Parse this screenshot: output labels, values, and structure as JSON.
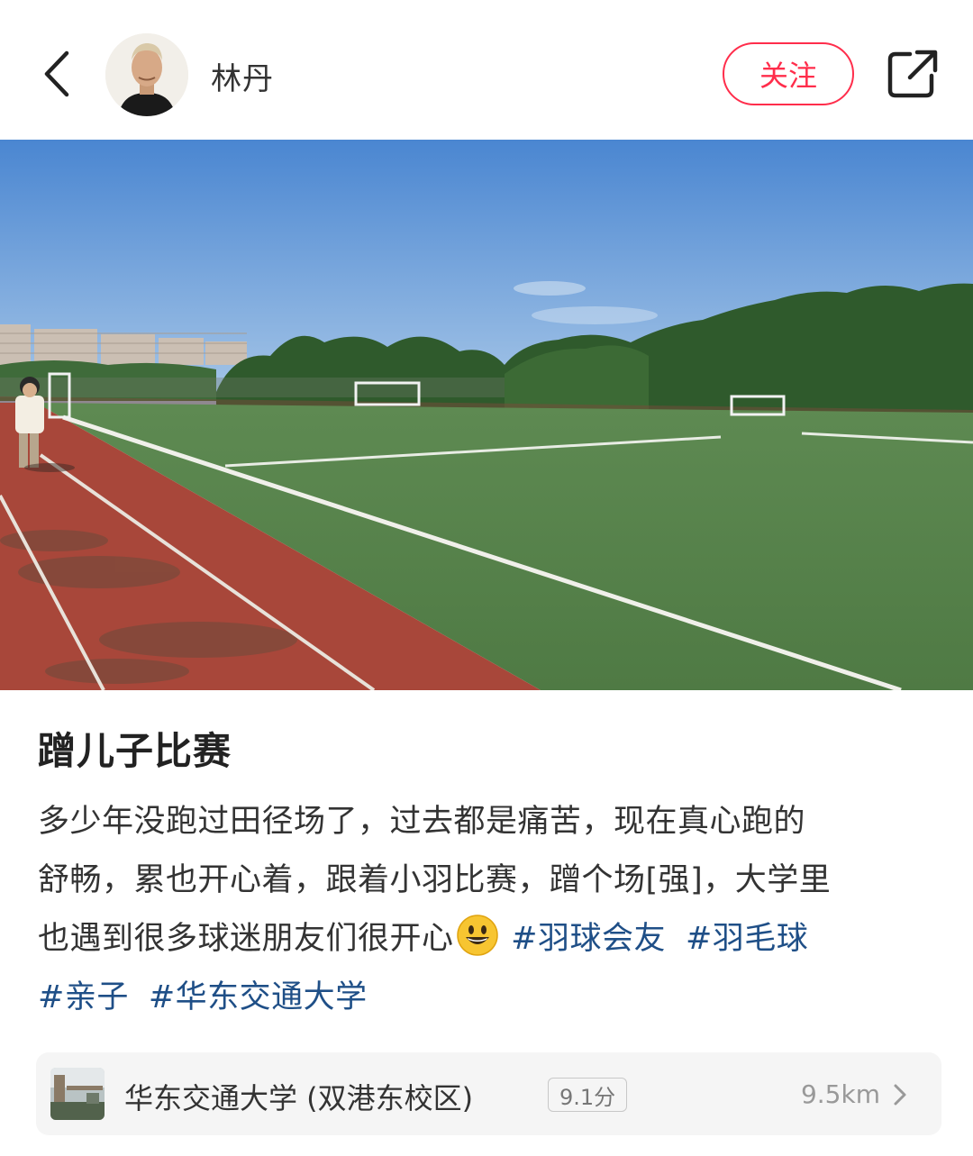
{
  "header": {
    "author_name": "林丹",
    "follow_label": "关注"
  },
  "post": {
    "title": "蹭儿子比赛",
    "body_line1": "多少年没跑过田径场了，过去都是痛苦，现在真心跑的",
    "body_line2": "舒畅，累也开心着，跟着小羽比赛，蹭个场[强]，大学里",
    "body_line3": "也遇到很多球迷朋友们很开心",
    "tags": [
      "#羽球会友",
      "#羽毛球",
      "#亲子",
      "#华东交通大学"
    ]
  },
  "location": {
    "name": "华东交通大学 (双港东校区)",
    "score": "9.1分",
    "distance": "9.5km"
  },
  "icons": {
    "back": "chevron-left-icon",
    "share": "share-external-icon",
    "emoji": "grinning-face-emoji",
    "location_chevron": "chevron-right-icon"
  },
  "colors": {
    "accent": "#ff2d4b",
    "tag": "#1f4f87"
  }
}
